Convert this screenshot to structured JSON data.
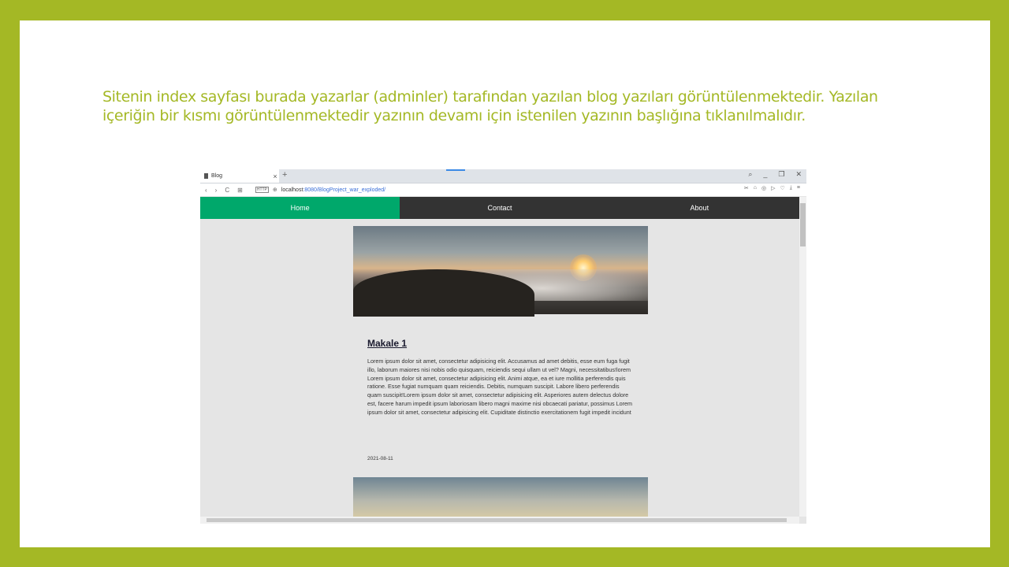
{
  "caption": "Sitenin index sayfası burada yazarlar (adminler) tarafından yazılan blog yazıları görüntülenmektedir. Yazılan içeriğin bir kısmı görüntülenmektedir yazının devamı için istenilen yazının başlığına tıklanılmalıdır.",
  "browser": {
    "tab_title": "Blog",
    "tab_close": "×",
    "new_tab": "+",
    "window_controls": [
      "⌕",
      "_",
      "❐",
      "✕"
    ],
    "nav": [
      "‹",
      "›",
      "C",
      "⊞"
    ],
    "badge": "HTTP",
    "url_host": "localhost",
    "url_path": ":8080/BlogProject_war_exploded/",
    "tools": [
      "✂",
      "⌂",
      "◎",
      "▷",
      "♡",
      "⤓",
      "≡"
    ]
  },
  "site_nav": {
    "items": [
      "Home",
      "Contact",
      "About"
    ],
    "active_color": "#00a86b",
    "bar_color": "#333333"
  },
  "post": {
    "title": "Makale 1",
    "body": "Lorem ipsum dolor sit amet, consectetur adipisicing elit. Accusamus ad amet debitis, esse eum fuga fugit illo, laborum maiores nisi nobis odio quisquam, reiciendis sequi ullam ut vel? Magni, necessitatibus!lorem Lorem ipsum dolor sit amet, consectetur adipisicing elit. Animi atque, ea et iure mollitia perferendis quis ratione. Esse fugiat numquam quam reiciendis. Debitis, numquam suscipit. Labore libero perferendis quam suscipit!Lorem ipsum dolor sit amet, consectetur adipisicing elit. Asperiores autem delectus dolore est, facere harum impedit ipsum laboriosam libero magni maxime nisi obcaecati pariatur, possimus Lorem ipsum dolor sit amet, consectetur adipisicing elit. Cupiditate distinctio exercitationem fugit impedit incidunt",
    "date": "2021-08-11"
  }
}
